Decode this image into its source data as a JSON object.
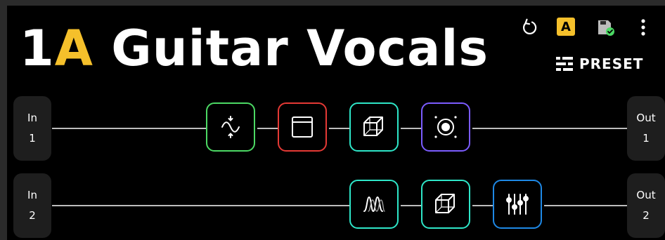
{
  "preset": {
    "number": "1",
    "letter": "A",
    "name": "Guitar Vocals"
  },
  "toolbar": {
    "undo_icon": "undo-icon",
    "snapshot_label": "A",
    "save_icon": "save-icon",
    "more_icon": "more-vertical-icon",
    "preset_label": "PRESET",
    "preset_icon": "preset-list-icon"
  },
  "rows": [
    {
      "input": {
        "label": "In",
        "number": "1"
      },
      "output": {
        "label": "Out",
        "number": "1"
      },
      "blocks": [
        {
          "icon": "wah-icon",
          "color": "#4cd964"
        },
        {
          "icon": "amp-icon",
          "color": "#e53935"
        },
        {
          "icon": "cab-icon",
          "color": "#2ee6c8"
        },
        {
          "icon": "speaker-icon",
          "color": "#7b5cff"
        }
      ]
    },
    {
      "input": {
        "label": "In",
        "number": "2"
      },
      "output": {
        "label": "Out",
        "number": "2"
      },
      "blocks": [
        {
          "icon": "reverb-icon",
          "color": "#2ee6c8"
        },
        {
          "icon": "cab-icon",
          "color": "#2ee6c8"
        },
        {
          "icon": "eq-icon",
          "color": "#1e88e5"
        }
      ]
    }
  ]
}
